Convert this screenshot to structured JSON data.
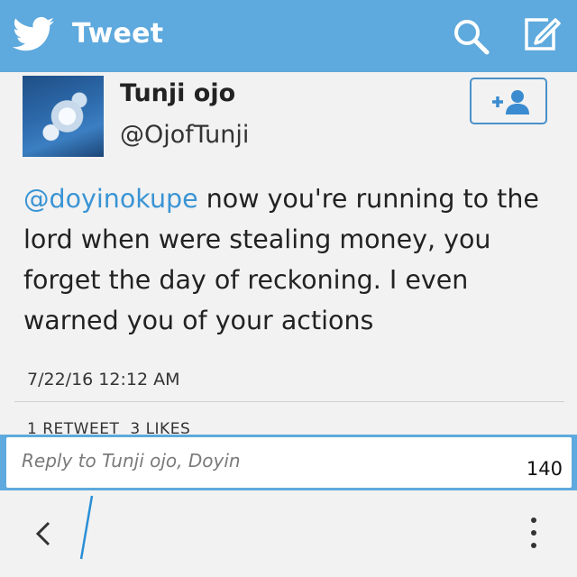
{
  "header": {
    "title": "Tweet",
    "icons": [
      "twitter-bird-icon",
      "search-icon",
      "compose-icon"
    ],
    "color": "#5ea9dd"
  },
  "tweet": {
    "name": "Tunji ojo",
    "handle": "@OjofTunji",
    "mention": "@doyinokupe",
    "text": " now you're running to the lord when were stealing money, you forget the day of reckoning. I even warned you of your actions",
    "timestamp": "7/22/16 12:12 AM",
    "retweets_label": "1 RETWEET",
    "likes_label": "3 LIKES",
    "follow_icon": "add-user-icon",
    "mention_color": "#3a94d4"
  },
  "reply": {
    "placeholder": "Reply to Tunji ojo, Doyin",
    "char_count": "140"
  },
  "bottom_bar": {
    "icons": [
      "back-chevron-icon",
      "more-vertical-icon"
    ]
  }
}
